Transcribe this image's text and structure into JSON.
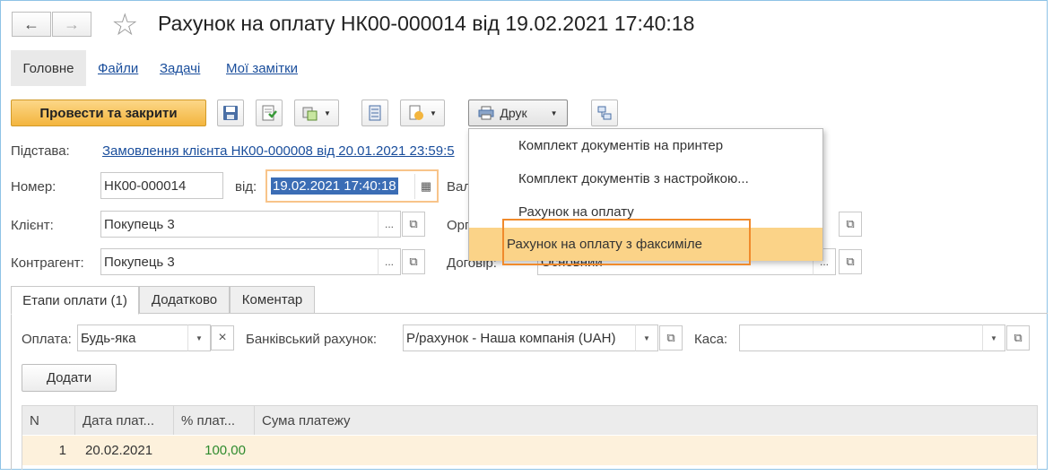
{
  "window": {
    "title": "Рахунок на оплату НК00-000014 від 19.02.2021 17:40:18"
  },
  "nav": {
    "back_icon": "←",
    "forward_icon": "→",
    "star_icon": "☆"
  },
  "tabs": {
    "main": "Головне",
    "files": "Файли",
    "tasks": "Задачі",
    "notes": "Мої замітки"
  },
  "toolbar": {
    "post_close": "Провести та закрити",
    "print": "Друк"
  },
  "form": {
    "basis_label": "Підстава:",
    "basis_value": "Замовлення клієнта НК00-000008 від 20.01.2021 23:59:5",
    "number_label": "Номер:",
    "number_value": "НК00-000014",
    "date_label": "від:",
    "date_value": "19.02.2021 17:40:18",
    "currency_label_partial": "Вал",
    "client_label": "Клієнт:",
    "client_value": "Покупець 3",
    "org_label_partial": "Орг",
    "counterparty_label": "Контрагент:",
    "counterparty_value": "Покупець 3",
    "contract_label": "Договір:",
    "contract_value_partial": "Основний",
    "ellipsis": "...",
    "open_icon": "⧉"
  },
  "print_menu": {
    "items": [
      "Комплект документів на принтер",
      "Комплект документів з настройкою...",
      "Рахунок на оплату",
      "Рахунок на оплату з факсиміле"
    ]
  },
  "subtabs": {
    "stages": "Етапи оплати (1)",
    "additional": "Додатково",
    "comment": "Коментар"
  },
  "payment": {
    "payment_label": "Оплата:",
    "payment_value": "Будь-яка",
    "clear_icon": "×",
    "bank_label": "Банківський рахунок:",
    "bank_value": "Р/рахунок - Наша компанія (UAH)",
    "cash_label": "Каса:",
    "cash_value": "",
    "add_button": "Додати"
  },
  "table": {
    "columns": [
      "N",
      "Дата плат...",
      "% плат...",
      "Сума платежу"
    ],
    "rows": [
      {
        "n": "1",
        "date": "20.02.2021",
        "percent": "100,00",
        "sum": ""
      }
    ]
  },
  "colors": {
    "accent_orange": "#f08a2b",
    "selected_row": "#fdf1dc",
    "menu_selected": "#fbd388",
    "link_blue": "#1a4e9c",
    "percent_green": "#2e8b2e"
  }
}
